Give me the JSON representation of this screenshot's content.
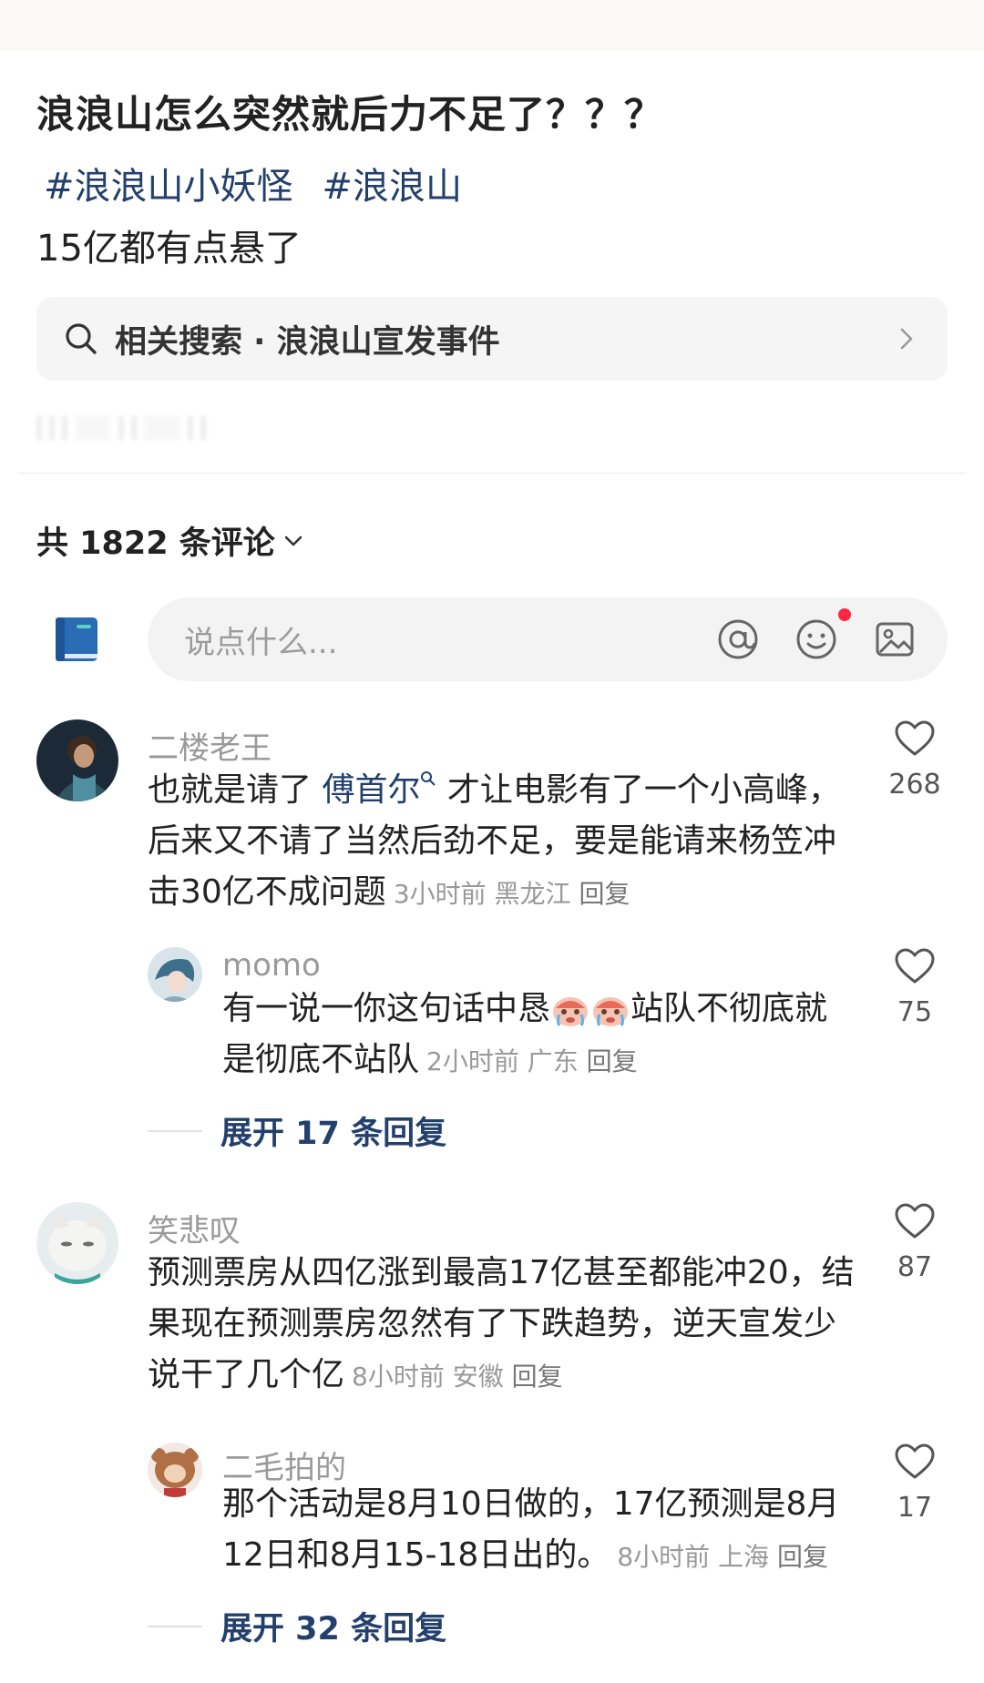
{
  "post": {
    "title": "浪浪山怎么突然就后力不足了？？？",
    "tags": [
      "#浪浪山小妖怪",
      "#浪浪山"
    ],
    "body": "15亿都有点悬了"
  },
  "related_search": {
    "label": "相关搜索 · 浪浪山宣发事件"
  },
  "comments_header": {
    "count_label": "共 1822 条评论"
  },
  "input": {
    "placeholder": "说点什么..."
  },
  "comments": [
    {
      "name": "二楼老王",
      "text_before": "也就是请了 ",
      "mention": "傅首尔",
      "text_after": " 才让电影有了一个小高峰，后来又不请了当然后劲不足，要是能请来杨笠冲击30亿不成问题",
      "time": "3小时前",
      "location": "黑龙江",
      "reply": "回复",
      "likes": "268",
      "replies": [
        {
          "name": "momo",
          "text_before": "有一说一你这句话中恳",
          "text_after": "站队不彻底就是彻底不站队",
          "time": "2小时前",
          "location": "广东",
          "reply": "回复",
          "likes": "75"
        }
      ],
      "expand": "展开 17 条回复"
    },
    {
      "name": "笑悲叹",
      "text": "预测票房从四亿涨到最高17亿甚至都能冲20，结果现在预测票房忽然有了下跌趋势，逆天宣发少说干了几个亿",
      "time": "8小时前",
      "location": "安徽",
      "reply": "回复",
      "likes": "87",
      "replies": [
        {
          "name": "二毛拍的",
          "text": "那个活动是8月10日做的，17亿预测是8月12日和8月15-18日出的。",
          "time": "8小时前",
          "location": "上海",
          "reply": "回复",
          "likes": "17"
        }
      ],
      "expand": "展开 32 条回复"
    }
  ],
  "colors": {
    "link": "#23406c",
    "notice_dot": "#ff2742",
    "book_icon": "#2a6bb5"
  },
  "icons": [
    "search-icon",
    "chevron-right-icon",
    "chevron-down-icon",
    "notebook-icon",
    "at-icon",
    "emoji-icon",
    "image-icon",
    "heart-icon",
    "crying-emoji-icon"
  ]
}
